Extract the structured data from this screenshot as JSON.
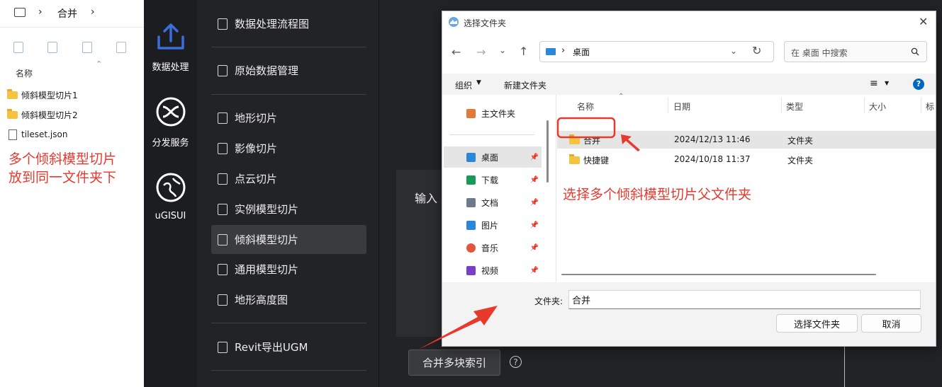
{
  "explorer": {
    "breadcrumb_sep": "›",
    "breadcrumb_current": "合并",
    "column_header": "名称",
    "items": [
      {
        "name": "倾斜模型切片1",
        "icon": "folder-icon"
      },
      {
        "name": "倾斜模型切片2",
        "icon": "folder-icon"
      },
      {
        "name": "tileset.json",
        "icon": "file-icon"
      }
    ],
    "note_line1": "多个倾斜模型切片",
    "note_line2": "放到同一文件夹下"
  },
  "rail": [
    {
      "label": "数据处理",
      "icon": "upload-icon"
    },
    {
      "label": "分发服务",
      "icon": "share-icon"
    },
    {
      "label": "uGISUI",
      "icon": "globe-icon"
    }
  ],
  "menu": [
    {
      "label": "数据处理流程图"
    },
    {
      "label": "原始数据管理"
    },
    {
      "label": "地形切片"
    },
    {
      "label": "影像切片"
    },
    {
      "label": "点云切片"
    },
    {
      "label": "实例模型切片"
    },
    {
      "label": "倾斜模型切片"
    },
    {
      "label": "通用模型切片"
    },
    {
      "label": "地形高度图"
    },
    {
      "label": "Revit导出UGM"
    }
  ],
  "panel": {
    "input_label": "输入",
    "merge_button": "合并多块索引",
    "help": "?"
  },
  "dialog": {
    "title": "选择文件夹",
    "close": "✕",
    "address": "桌面",
    "search_placeholder": "在 桌面 中搜索",
    "organize": "组织",
    "new_folder": "新建文件夹",
    "help": "?",
    "nav": [
      {
        "label": "主文件夹",
        "icon": "home-icon",
        "color": "#e07b39"
      },
      {
        "label": "桌面",
        "icon": "desktop-icon",
        "color": "#2b88d8"
      },
      {
        "label": "下载",
        "icon": "download-icon",
        "color": "#1a9a5a"
      },
      {
        "label": "文档",
        "icon": "document-icon",
        "color": "#6b7b8c"
      },
      {
        "label": "图片",
        "icon": "picture-icon",
        "color": "#2b88d8"
      },
      {
        "label": "音乐",
        "icon": "music-icon",
        "color": "#e2573b"
      },
      {
        "label": "视频",
        "icon": "video-icon",
        "color": "#7a3fc7"
      }
    ],
    "columns": [
      "名称",
      "日期",
      "类型",
      "大小",
      "标"
    ],
    "rows": [
      {
        "name": "合并",
        "date": "2024/12/13 11:46",
        "type": "文件夹"
      },
      {
        "name": "快捷键",
        "date": "2024/10/18 11:37",
        "type": "文件夹"
      }
    ],
    "note": "选择多个倾斜模型切片父文件夹",
    "folder_label": "文件夹:",
    "folder_value": "合并",
    "select_button": "选择文件夹",
    "cancel_button": "取消"
  },
  "colors": {
    "annotation_red": "#e8392d",
    "rail_bg": "#1c1d20",
    "app_bg": "#222326",
    "accent_blue": "#0067c0"
  }
}
